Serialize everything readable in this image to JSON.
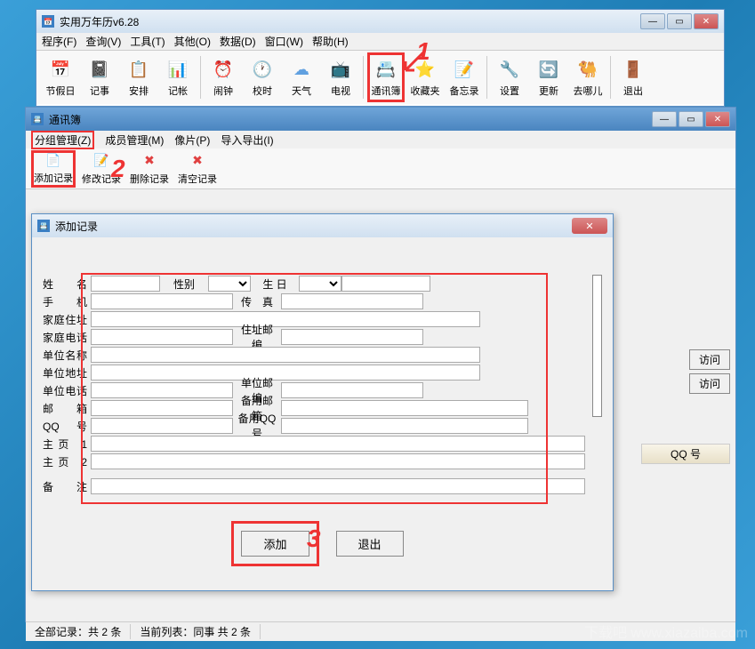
{
  "main": {
    "title": "实用万年历v6.28",
    "menu": [
      "程序(F)",
      "查询(V)",
      "工具(T)",
      "其他(O)",
      "数据(D)",
      "窗口(W)",
      "帮助(H)"
    ],
    "toolbar": [
      {
        "label": "节假日",
        "icon": "📅"
      },
      {
        "label": "记事",
        "icon": "📓"
      },
      {
        "label": "安排",
        "icon": "📋"
      },
      {
        "label": "记帐",
        "icon": "📊"
      },
      {
        "label": "闹钟",
        "icon": "⏰"
      },
      {
        "label": "校时",
        "icon": "🕐"
      },
      {
        "label": "天气",
        "icon": "☁"
      },
      {
        "label": "电视",
        "icon": "📺"
      },
      {
        "label": "通讯簿",
        "icon": "📇"
      },
      {
        "label": "收藏夹",
        "icon": "⭐"
      },
      {
        "label": "备忘录",
        "icon": "📝"
      },
      {
        "label": "设置",
        "icon": "🔧"
      },
      {
        "label": "更新",
        "icon": "🔄"
      },
      {
        "label": "去哪儿",
        "icon": "🐫"
      },
      {
        "label": "退出",
        "icon": "🚪"
      }
    ]
  },
  "contacts": {
    "title": "通讯簿",
    "menu": [
      "分组管理(Z)",
      "成员管理(M)",
      "像片(P)",
      "导入导出(I)"
    ],
    "toolbar": [
      {
        "label": "添加记录",
        "icon": "📄"
      },
      {
        "label": "修改记录",
        "icon": "📝"
      },
      {
        "label": "删除记录",
        "icon": "✖"
      },
      {
        "label": "清空记录",
        "icon": "✖"
      }
    ],
    "visit_btn": "访问",
    "qq_col": "QQ 号",
    "status_all": "全部记录：共 2 条",
    "status_current": "当前列表：同事 共 2 条"
  },
  "dialog": {
    "title": "添加记录",
    "labels": {
      "name": "姓　名",
      "gender": "性别",
      "birthday": "生 日",
      "mobile": "手　机",
      "fax": "传　真",
      "home_addr": "家庭住址",
      "home_phone": "家庭电话",
      "addr_zip": "住址邮编",
      "company": "单位名称",
      "company_addr": "单位地址",
      "company_phone": "单位电话",
      "company_zip": "单位邮编",
      "email": "邮　箱",
      "email2": "备用邮箱",
      "qq": "QQ　号",
      "qq2": "备用QQ号",
      "homepage1": "主页 1",
      "homepage2": "主页 2",
      "remark": "备　注"
    },
    "add_btn": "添加",
    "exit_btn": "退出"
  },
  "annotations": {
    "n1": "1",
    "n2": "2",
    "n3": "3"
  },
  "watermark": "下载吧 www.xiazaiba.com"
}
